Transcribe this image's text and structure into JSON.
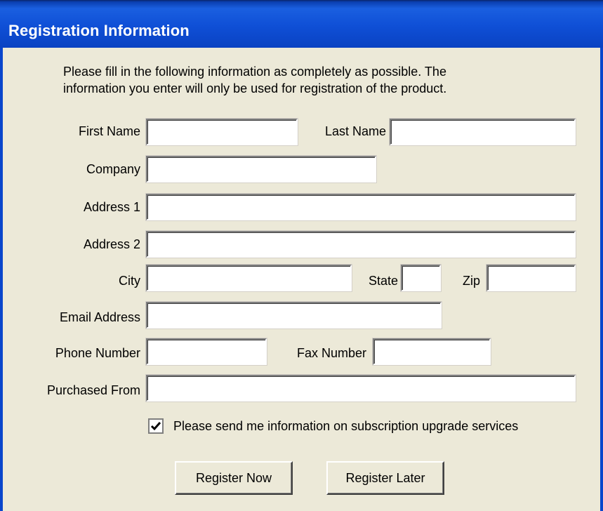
{
  "window": {
    "title": "Registration Information"
  },
  "intro": {
    "text": "Please fill in the following information as completely as possible.  The\ninformation you enter will only be used for registration of the product."
  },
  "form": {
    "first_name": {
      "label": "First Name",
      "value": ""
    },
    "last_name": {
      "label": "Last Name",
      "value": ""
    },
    "company": {
      "label": "Company",
      "value": ""
    },
    "address1": {
      "label": "Address 1",
      "value": ""
    },
    "address2": {
      "label": "Address 2",
      "value": ""
    },
    "city": {
      "label": "City",
      "value": ""
    },
    "state": {
      "label": "State",
      "value": ""
    },
    "zip": {
      "label": "Zip",
      "value": ""
    },
    "email": {
      "label": "Email Address",
      "value": ""
    },
    "phone": {
      "label": "Phone Number",
      "value": ""
    },
    "fax": {
      "label": "Fax Number",
      "value": ""
    },
    "purchased_from": {
      "label": "Purchased From",
      "value": ""
    },
    "subscribe": {
      "label": "Please send me information on subscription upgrade services",
      "checked": true
    }
  },
  "buttons": {
    "register_now": "Register Now",
    "register_later": "Register Later"
  },
  "colors": {
    "title_bar": "#0f4fd6",
    "dialog_background": "#ece9d8",
    "title_text": "#ffffff"
  }
}
